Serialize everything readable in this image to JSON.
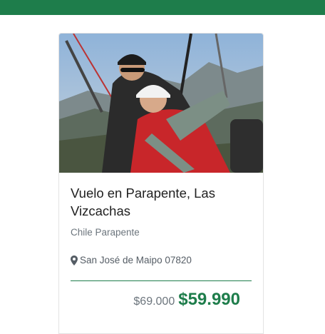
{
  "colors": {
    "brand": "#1e7d4b",
    "title_text": "#212121",
    "muted_text": "#6c757d"
  },
  "card": {
    "image_description_icon": "paragliding-photo",
    "title": "Vuelo en Parapente, Las Vizcachas",
    "provider": "Chile Parapente",
    "location_icon": "map-pin-icon",
    "location": "San José de Maipo 07820",
    "old_price": "$69.000",
    "price": "$59.990"
  }
}
